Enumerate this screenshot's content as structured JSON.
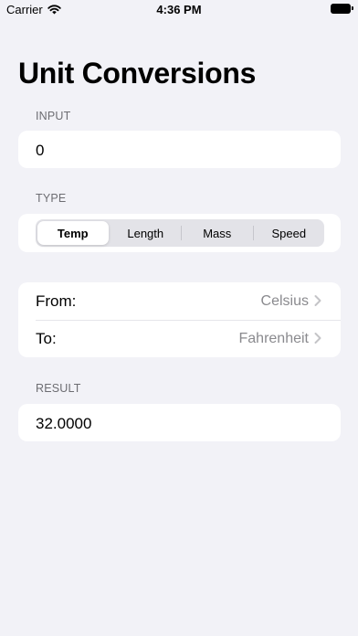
{
  "status_bar": {
    "carrier": "Carrier",
    "time": "4:36 PM",
    "icons": [
      "wifi-icon",
      "battery-icon"
    ]
  },
  "title": "Unit Conversions",
  "input_section": {
    "header": "INPUT",
    "value": "0"
  },
  "type_section": {
    "header": "TYPE",
    "segments": [
      "Temp",
      "Length",
      "Mass",
      "Speed"
    ],
    "selected": "Temp"
  },
  "units": {
    "from_label": "From:",
    "from_value": "Celsius",
    "to_label": "To:",
    "to_value": "Fahrenheit",
    "icons": [
      "chevron-right-icon"
    ]
  },
  "result_section": {
    "header": "RESULT",
    "value": "32.0000"
  },
  "colors": {
    "background": "#f2f2f7",
    "card": "#ffffff",
    "secondary_text": "#6d6d72",
    "detail_text": "#8a8a8e"
  }
}
